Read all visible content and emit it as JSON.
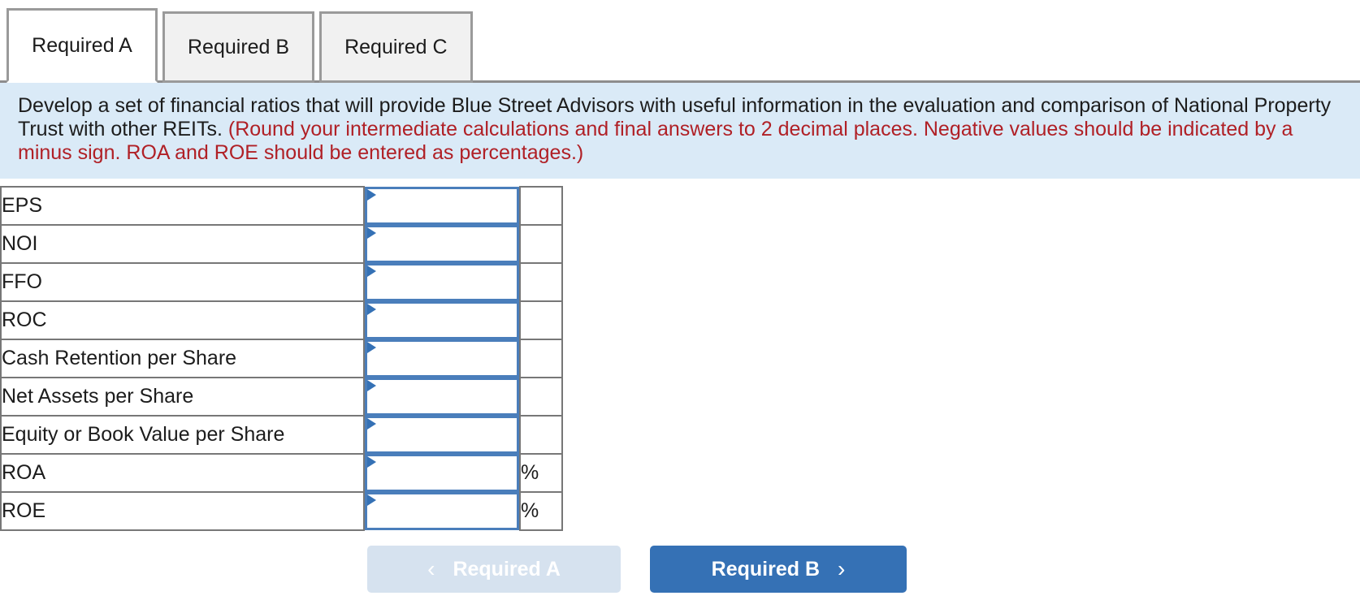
{
  "tabs": [
    {
      "label": "Required A",
      "active": true
    },
    {
      "label": "Required B",
      "active": false
    },
    {
      "label": "Required C",
      "active": false
    }
  ],
  "instructions": {
    "main": "Develop a set of financial ratios that will provide Blue Street Advisors with useful information in the evaluation and comparison of National Property Trust with other REITs.",
    "note": "(Round your intermediate calculations and final answers to 2 decimal places. Negative values should be indicated by a minus sign. ROA and ROE should be entered as percentages.)"
  },
  "table": {
    "rows": [
      {
        "label": "EPS",
        "value": "",
        "unit": ""
      },
      {
        "label": "NOI",
        "value": "",
        "unit": ""
      },
      {
        "label": "FFO",
        "value": "",
        "unit": ""
      },
      {
        "label": "ROC",
        "value": "",
        "unit": ""
      },
      {
        "label": "Cash Retention per Share",
        "value": "",
        "unit": ""
      },
      {
        "label": "Net Assets per Share",
        "value": "",
        "unit": ""
      },
      {
        "label": "Equity or Book Value per Share",
        "value": "",
        "unit": ""
      },
      {
        "label": "ROA",
        "value": "",
        "unit": "%"
      },
      {
        "label": "ROE",
        "value": "",
        "unit": "%"
      }
    ]
  },
  "nav": {
    "prev_label": "Required A",
    "prev_icon": "chevron-left-icon",
    "prev_glyph": "‹",
    "next_label": "Required B",
    "next_icon": "chevron-right-icon",
    "next_glyph": "›"
  },
  "colors": {
    "banner_bg": "#daeaf7",
    "note_red": "#b02026",
    "primary_blue": "#3571b5",
    "input_border": "#4a7ebb",
    "disabled_btn": "#d6e2ef",
    "table_border": "#777777"
  }
}
